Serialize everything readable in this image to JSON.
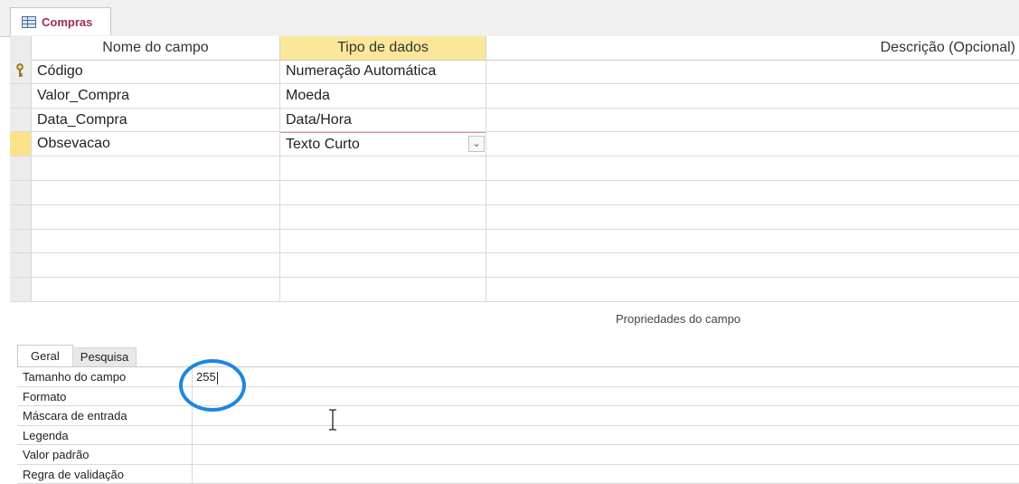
{
  "document_tab": {
    "label": "Compras",
    "icon": "table-icon"
  },
  "grid": {
    "headers": {
      "field_name": "Nome do campo",
      "data_type": "Tipo de dados",
      "description": "Descrição (Opcional)"
    },
    "rows": [
      {
        "name": "Código",
        "type": "Numeração Automática",
        "description": "",
        "primary_key": true
      },
      {
        "name": "Valor_Compra",
        "type": "Moeda",
        "description": ""
      },
      {
        "name": "Data_Compra",
        "type": "Data/Hora",
        "description": ""
      },
      {
        "name": "Obsevacao",
        "type": "Texto Curto",
        "description": "",
        "current": true
      }
    ]
  },
  "properties": {
    "title": "Propriedades do campo",
    "tabs": [
      "Geral",
      "Pesquisa"
    ],
    "rows": [
      {
        "label": "Tamanho do campo",
        "value": "255"
      },
      {
        "label": "Formato",
        "value": ""
      },
      {
        "label": "Máscara de entrada",
        "value": ""
      },
      {
        "label": "Legenda",
        "value": ""
      },
      {
        "label": "Valor padrão",
        "value": ""
      },
      {
        "label": "Regra de validação",
        "value": ""
      }
    ]
  },
  "colors": {
    "header_highlight": "#fbe79a",
    "tab_label": "#9c2a55",
    "annotation_circle": "#1f86e0"
  }
}
